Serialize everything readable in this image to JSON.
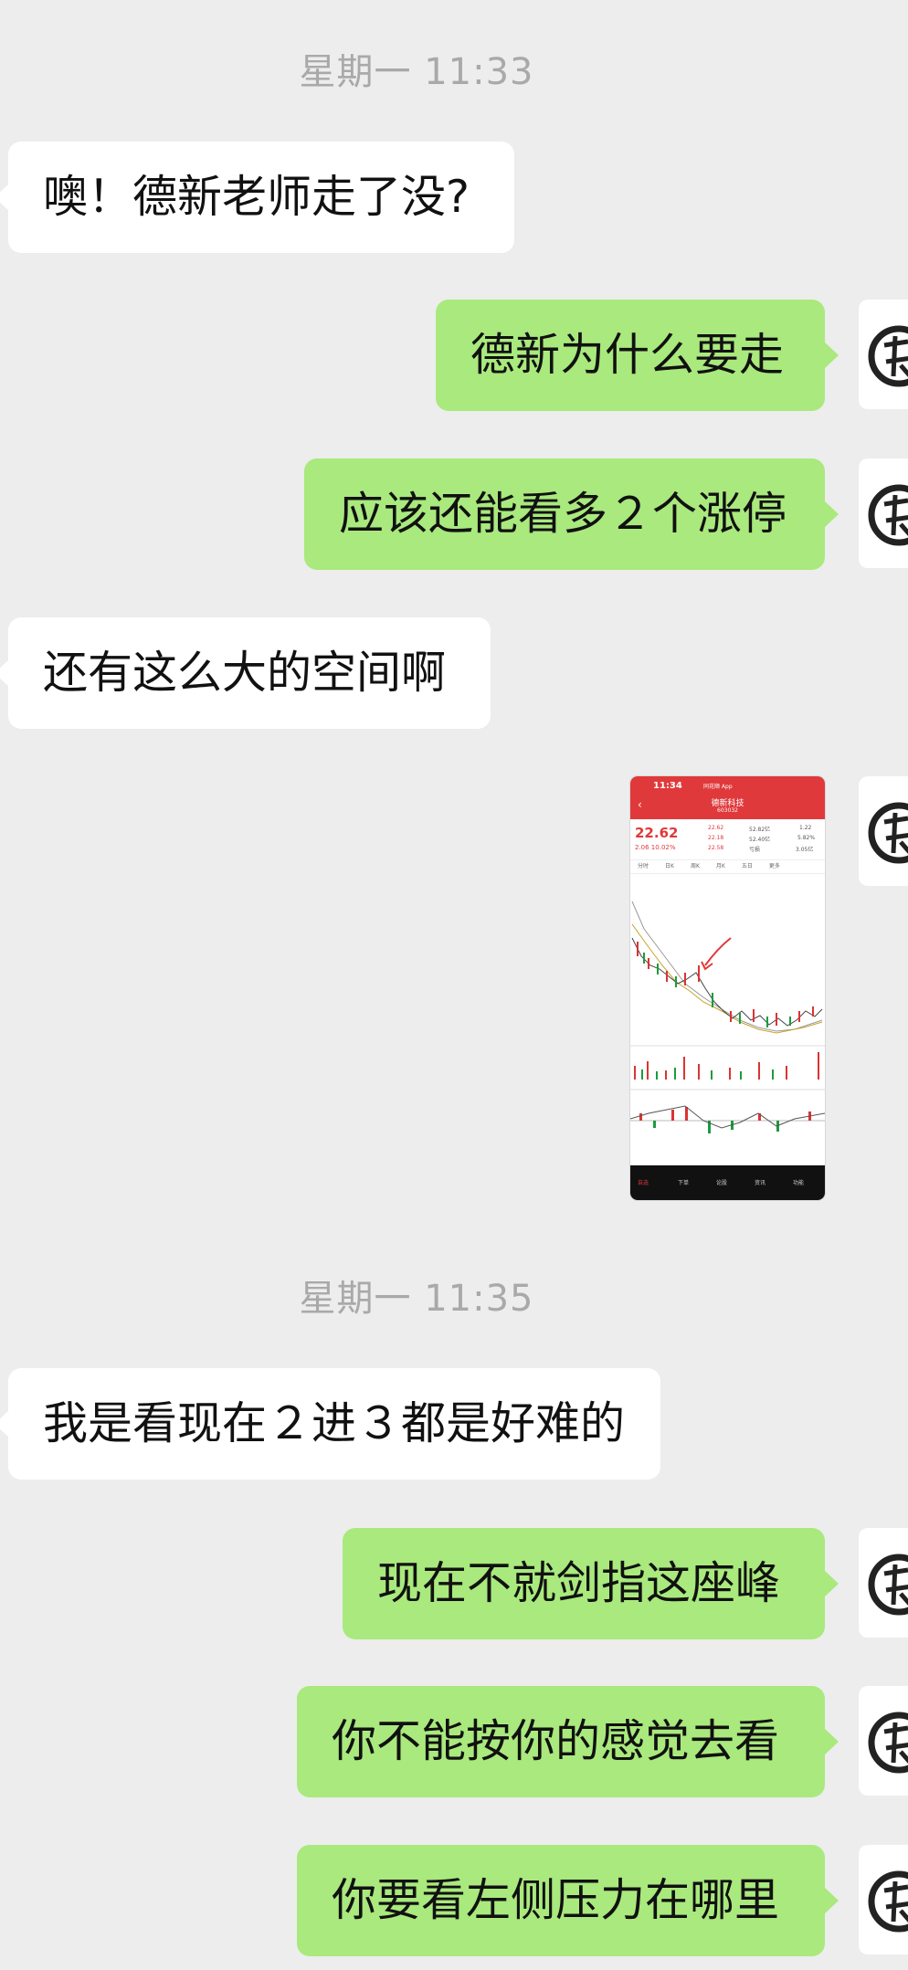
{
  "messages": [
    {
      "type": "time",
      "text": "星期一 11:33"
    },
    {
      "type": "in",
      "text": "噢！德新老师走了没?"
    },
    {
      "type": "out",
      "text": "德新为什么要走"
    },
    {
      "type": "out",
      "text": "应该还能看多２个涨停"
    },
    {
      "type": "in",
      "text": "还有这么大的空间啊"
    },
    {
      "type": "out_image",
      "label": "stock-chart-screenshot"
    },
    {
      "type": "time",
      "text": "星期一 11:35"
    },
    {
      "type": "in",
      "text": "我是看现在２进３都是好难的"
    },
    {
      "type": "out",
      "text": "现在不就剑指这座峰"
    },
    {
      "type": "out",
      "text": "你不能按你的感觉去看"
    },
    {
      "type": "out",
      "text": "你要看左侧压力在哪里"
    }
  ],
  "stock_thumb": {
    "clock": "11:34",
    "app": "同花顺 App",
    "name": "德新科技",
    "code": "603032",
    "price": "22.62",
    "change": "2.06  10.02%",
    "stats": [
      "22.62",
      "52.82亿",
      "1.22",
      "22.18",
      "52.40亿",
      "5.82%",
      "22.58",
      "亏损",
      "3.05亿"
    ],
    "tabs": [
      "分时",
      "日K",
      "周K",
      "月K",
      "五日",
      "更多"
    ],
    "footer": [
      "自选",
      "下单",
      "论股",
      "资讯",
      "功能"
    ]
  },
  "colors": {
    "background": "#ededed",
    "incoming_bubble": "#ffffff",
    "outgoing_bubble": "#a9e97d",
    "timestamp": "#a9a9a9",
    "stock_red": "#e0393b"
  }
}
